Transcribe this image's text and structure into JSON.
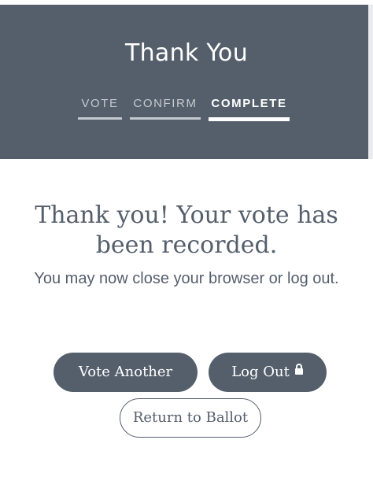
{
  "header": {
    "title": "Thank You",
    "steps": [
      {
        "label": "VOTE",
        "state": "done"
      },
      {
        "label": "CONFIRM",
        "state": "done"
      },
      {
        "label": "COMPLETE",
        "state": "active"
      }
    ]
  },
  "main": {
    "headline": "Thank you! Your vote has been recorded.",
    "subtext": "You may now close your browser or log out."
  },
  "actions": {
    "vote_another_label": "Vote Another",
    "logout_label": "Log Out",
    "logout_icon": "lock-icon",
    "return_label": "Return to Ballot"
  },
  "colors": {
    "header_bg": "#555f6c",
    "accent": "#555f6c",
    "inactive_step": "#c4c9d0"
  }
}
